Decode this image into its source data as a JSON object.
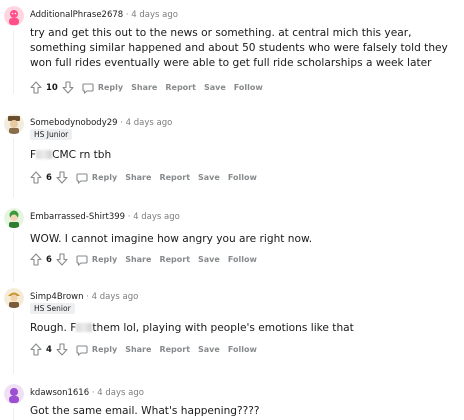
{
  "comments": [
    {
      "username": "AdditionalPhrase2678",
      "time": " · 4 days ago",
      "flair": "",
      "body": "try and get this out to the news or something. at central mich this year, something similar happened and about 50 students who were falsely told they won full rides eventually were able to get full ride scholarships a week later",
      "score": "10",
      "reply": "Reply",
      "share": "Share",
      "report": "Report",
      "save": "Save",
      "follow": "Follow"
    },
    {
      "username": "Somebodynobody29",
      "time": " · 4 days ago",
      "flair": "HS Junior",
      "body_pre": "F",
      "body_post": "CMC rn tbh",
      "score": "6",
      "reply": "Reply",
      "share": "Share",
      "report": "Report",
      "save": "Save",
      "follow": "Follow"
    },
    {
      "username": "Embarrassed-Shirt399",
      "time": " · 4 days ago",
      "flair": "",
      "body": "WOW. I cannot imagine how angry you are right now.",
      "score": "6",
      "reply": "Reply",
      "share": "Share",
      "report": "Report",
      "save": "Save",
      "follow": "Follow"
    },
    {
      "username": "Simp4Brown",
      "time": " · 4 days ago",
      "flair": "HS Senior",
      "body_pre": "Rough. F",
      "body_post": "them lol, playing with people's emotions like that",
      "score": "4",
      "reply": "Reply",
      "share": "Share",
      "report": "Report",
      "save": "Save",
      "follow": "Follow"
    },
    {
      "username": "kdawson1616",
      "time": " · 4 days ago",
      "flair": "",
      "body": "Got the same email. What's happening????"
    }
  ],
  "colors": {
    "meta_text": "#7c7c7c",
    "action_text": "#878a8c",
    "flair_bg": "#edeff1"
  },
  "icons": {
    "upvote": "upvote-icon",
    "downvote": "downvote-icon",
    "reply": "comment-bubble-icon"
  }
}
